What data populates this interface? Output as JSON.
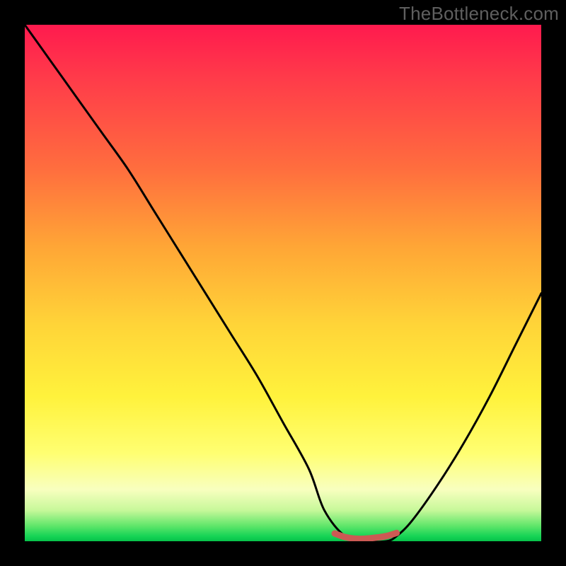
{
  "watermark": "TheBottleneck.com",
  "chart_data": {
    "type": "line",
    "title": "",
    "xlabel": "",
    "ylabel": "",
    "xlim": [
      0,
      100
    ],
    "ylim": [
      0,
      100
    ],
    "grid": false,
    "legend": false,
    "series": [
      {
        "name": "bottleneck-curve",
        "x": [
          0,
          5,
          10,
          15,
          20,
          25,
          30,
          35,
          40,
          45,
          50,
          55,
          58,
          62,
          66,
          70,
          72,
          75,
          80,
          85,
          90,
          95,
          100
        ],
        "y": [
          100,
          93,
          86,
          79,
          72,
          64,
          56,
          48,
          40,
          32,
          23,
          14,
          6,
          1,
          0,
          0,
          1,
          4,
          11,
          19,
          28,
          38,
          48
        ]
      },
      {
        "name": "valley-highlight",
        "x": [
          60,
          62,
          64,
          66,
          68,
          70,
          72
        ],
        "y": [
          1.5,
          0.8,
          0.5,
          0.5,
          0.7,
          1.0,
          1.6
        ]
      }
    ],
    "colors": {
      "curve": "#000000",
      "highlight": "#cc5a54",
      "gradient_top": "#ff1a4e",
      "gradient_mid": "#ffd438",
      "gradient_bottom": "#06c24a"
    }
  }
}
